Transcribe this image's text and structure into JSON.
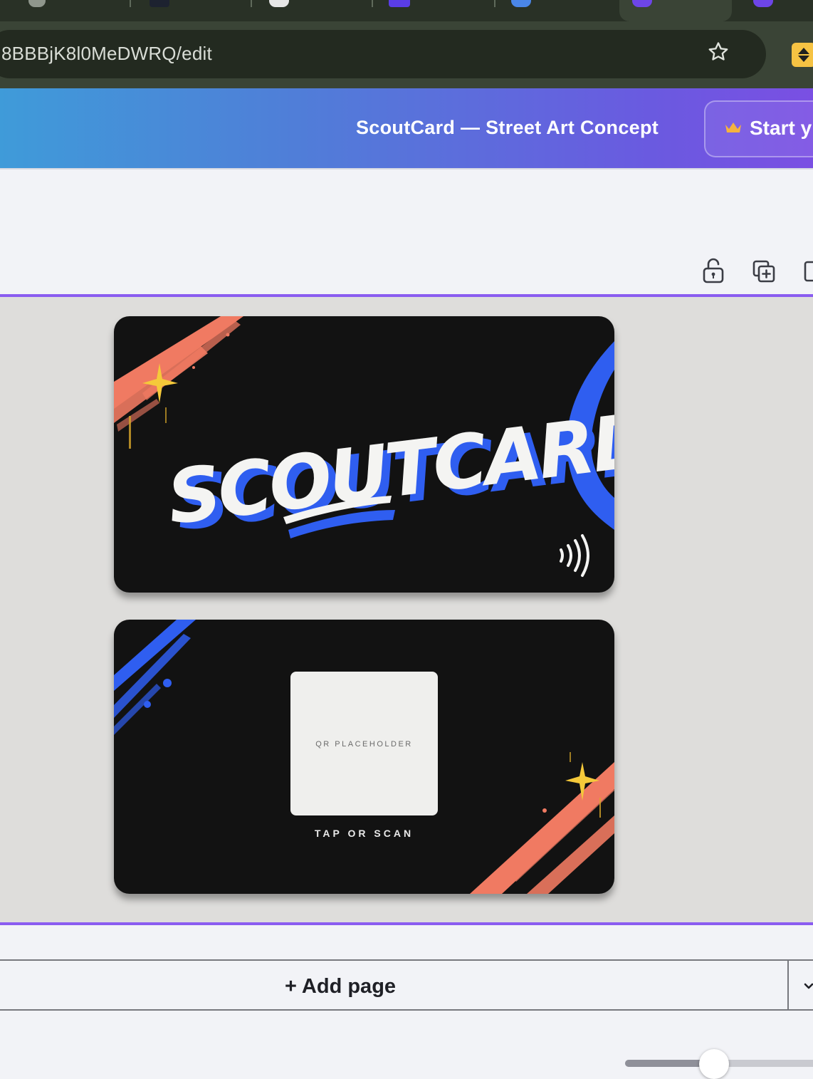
{
  "browser": {
    "url": "8BBBjK8l0MeDWRQ/edit",
    "bookmark_icon": "star-icon",
    "extension_icon": "extension-icon"
  },
  "header": {
    "title": "ScoutCard — Street Art Concept",
    "start_button_label": "Start y",
    "start_icon": "crown-icon"
  },
  "page_tools": [
    "lock-icon",
    "duplicate-page-icon",
    "add-page-icon"
  ],
  "design": {
    "front": {
      "logo_text": "SCOUTCARD",
      "contactless_icon": "nfc-icon"
    },
    "back": {
      "qr_text": "QR PLACEHOLDER",
      "tagline": "TAP OR SCAN"
    }
  },
  "footer": {
    "add_page_label": "+ Add page",
    "chevron_icon": "chevron-down-icon"
  },
  "colors": {
    "brand_gradient_start": "#3f9bd9",
    "brand_gradient_end": "#7a4fe3",
    "page_border": "#8a5cf0",
    "card_bg": "#121212",
    "accent_blue": "#2f5ef0",
    "accent_coral": "#f07a62",
    "accent_yellow": "#f5c93a"
  }
}
